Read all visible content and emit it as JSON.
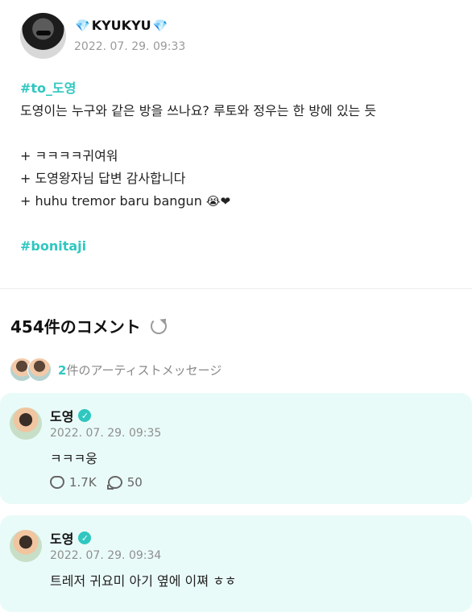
{
  "post": {
    "username": "KYUKYU",
    "date": "2022. 07. 29. 09:33",
    "lines": [
      "#to_도영",
      "도영이는 누구와 같은 방을 쓰나요? 루토와 정우는 한 방에 있는 듯",
      "",
      "+ ㅋㅋㅋㅋ귀여워",
      "+ 도영왕자님 답변 감사합니다",
      "+ huhu tremor baru bangun",
      "",
      "#bonitaji"
    ],
    "emojis": "😭❤"
  },
  "comments": {
    "header": "454件のコメント",
    "artist_count": "2",
    "artist_label": "件のアーティストメッセージ"
  },
  "comment_list": [
    {
      "name": "도영",
      "date": "2022. 07. 29. 09:35",
      "text": "ㅋㅋㅋ웅",
      "likes": "1.7K",
      "replies": "50"
    },
    {
      "name": "도영",
      "date": "2022. 07. 29. 09:34",
      "text": "트레저 귀요미 아기 옆에 이쪄 ㅎㅎ"
    }
  ],
  "colors": {
    "accent": "#2fc7c0",
    "card_bg": "#e9fbf8",
    "gem": "#1aa3e6"
  }
}
